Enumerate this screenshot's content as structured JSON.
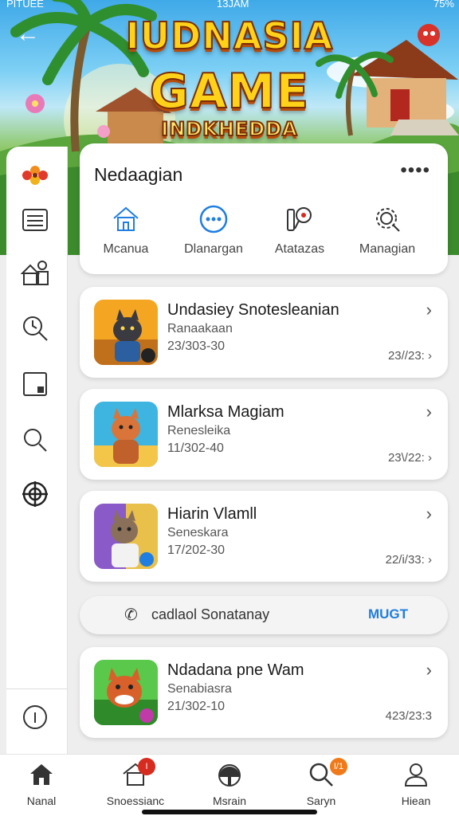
{
  "status_bar": {
    "carrier": "PITUEE",
    "time": "13JAM",
    "battery": "75%"
  },
  "banner": {
    "logo_line1": "IUDNASIA",
    "logo_line2": "GAME",
    "logo_line3": "INDKHEDDA"
  },
  "nav_card": {
    "title": "Nedaagian",
    "items": [
      {
        "label": "Mcanua",
        "icon": "home-icon"
      },
      {
        "label": "Dlanargan",
        "icon": "chat-dots-icon"
      },
      {
        "label": "Atatazas",
        "icon": "tools-icon"
      },
      {
        "label": "Managian",
        "icon": "gear-icon"
      }
    ]
  },
  "games": [
    {
      "title": "Undasiey Snotesleanian",
      "subtitle": "Ranaakaan",
      "date": "23/303-30",
      "stat": "23//23:"
    },
    {
      "title": "Mlarksa Magiam",
      "subtitle": "Renesleika",
      "date": "11/302-40",
      "stat": "23\\/22:"
    },
    {
      "title": "Hiarin Vlamll",
      "subtitle": "Seneskara",
      "date": "17/202-30",
      "stat": "22/i/33:"
    },
    {
      "title": "Ndadana pne Wam",
      "subtitle": "Senabiasra",
      "date": "21/302-10",
      "stat": "423/23:3"
    }
  ],
  "contact": {
    "text": "cadlaol Sonatanay",
    "action": "MUGT"
  },
  "tabs": [
    {
      "label": "Nanal",
      "icon": "home-icon",
      "badge": ""
    },
    {
      "label": "Snoessianc",
      "icon": "house-outline-icon",
      "badge": "I"
    },
    {
      "label": "Msrain",
      "icon": "helmet-icon",
      "badge": ""
    },
    {
      "label": "Saryn",
      "icon": "search-icon",
      "badge": "I/1"
    },
    {
      "label": "Hiean",
      "icon": "user-icon",
      "badge": ""
    }
  ],
  "colors": {
    "accent": "#1f7ee0",
    "badge_red": "#d62b1f",
    "badge_orange": "#f07a1a"
  }
}
